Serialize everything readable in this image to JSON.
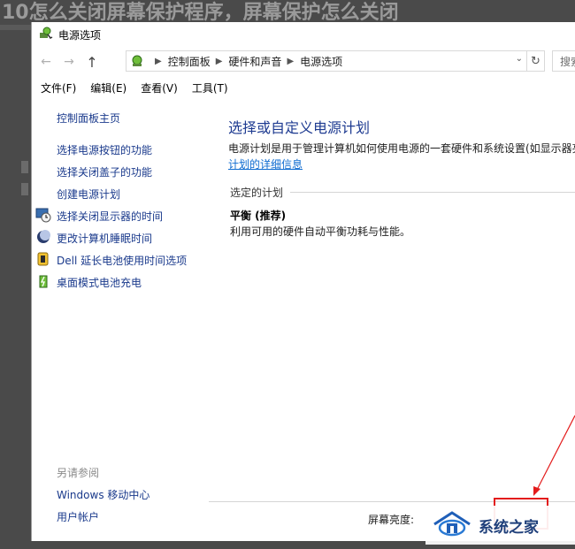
{
  "background": {
    "heading": "10怎么关闭屏幕保护程序，屏幕保护怎么关闭"
  },
  "window": {
    "title": "电源选项",
    "address": {
      "crumbs": [
        "控制面板",
        "硬件和声音",
        "电源选项"
      ],
      "search_placeholder": "搜索"
    },
    "menu": [
      "文件(F)",
      "编辑(E)",
      "查看(V)",
      "工具(T)"
    ],
    "left_pane": {
      "home": "控制面板主页",
      "links": [
        "选择电源按钮的功能",
        "选择关闭盖子的功能",
        "创建电源计划",
        "选择关闭显示器的时间",
        "更改计算机睡眠时间",
        "Dell 延长电池使用时间选项",
        "桌面模式电池充电"
      ],
      "see_also_title": "另请参阅",
      "see_also": [
        "Windows 移动中心",
        "用户帐户"
      ]
    },
    "main": {
      "title": "选择或自定义电源计划",
      "description": "电源计划是用于管理计算机如何使用电源的一套硬件和系统设置(如显示器亮",
      "detail_link": "计划的详细信息",
      "section_label": "选定的计划",
      "plan_name": "平衡 (推荐)",
      "plan_desc": "利用可用的硬件自动平衡功耗与性能。",
      "brightness_label": "屏幕亮度:"
    }
  },
  "watermark": {
    "text": "系统之家"
  },
  "colors": {
    "link": "#1a3a8c",
    "title": "#1e3b91",
    "annotation": "#e31b1b"
  }
}
